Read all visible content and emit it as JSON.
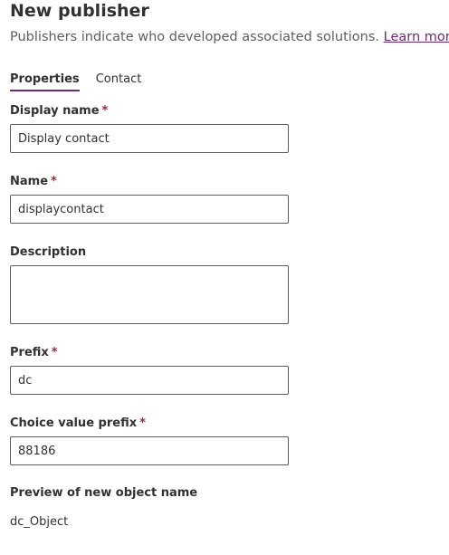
{
  "header": {
    "title": "New publisher",
    "subtitle": "Publishers indicate who developed associated solutions.",
    "learn_more": "Learn more"
  },
  "tabs": [
    {
      "label": "Properties",
      "active": true
    },
    {
      "label": "Contact",
      "active": false
    }
  ],
  "fields": {
    "display_name": {
      "label": "Display name",
      "required_mark": "*",
      "value": "Display contact"
    },
    "name": {
      "label": "Name",
      "required_mark": "*",
      "value": "displaycontact"
    },
    "description": {
      "label": "Description",
      "value": ""
    },
    "prefix": {
      "label": "Prefix",
      "required_mark": "*",
      "value": "dc"
    },
    "choice_value_prefix": {
      "label": "Choice value prefix",
      "required_mark": "*",
      "value": "88186"
    }
  },
  "preview": {
    "label": "Preview of new object name",
    "value": "dc_Object"
  },
  "colors": {
    "accent": "#742774",
    "required": "#a4262c",
    "text": "#323130",
    "subtle_text": "#605e5c",
    "border": "#605e5c"
  }
}
